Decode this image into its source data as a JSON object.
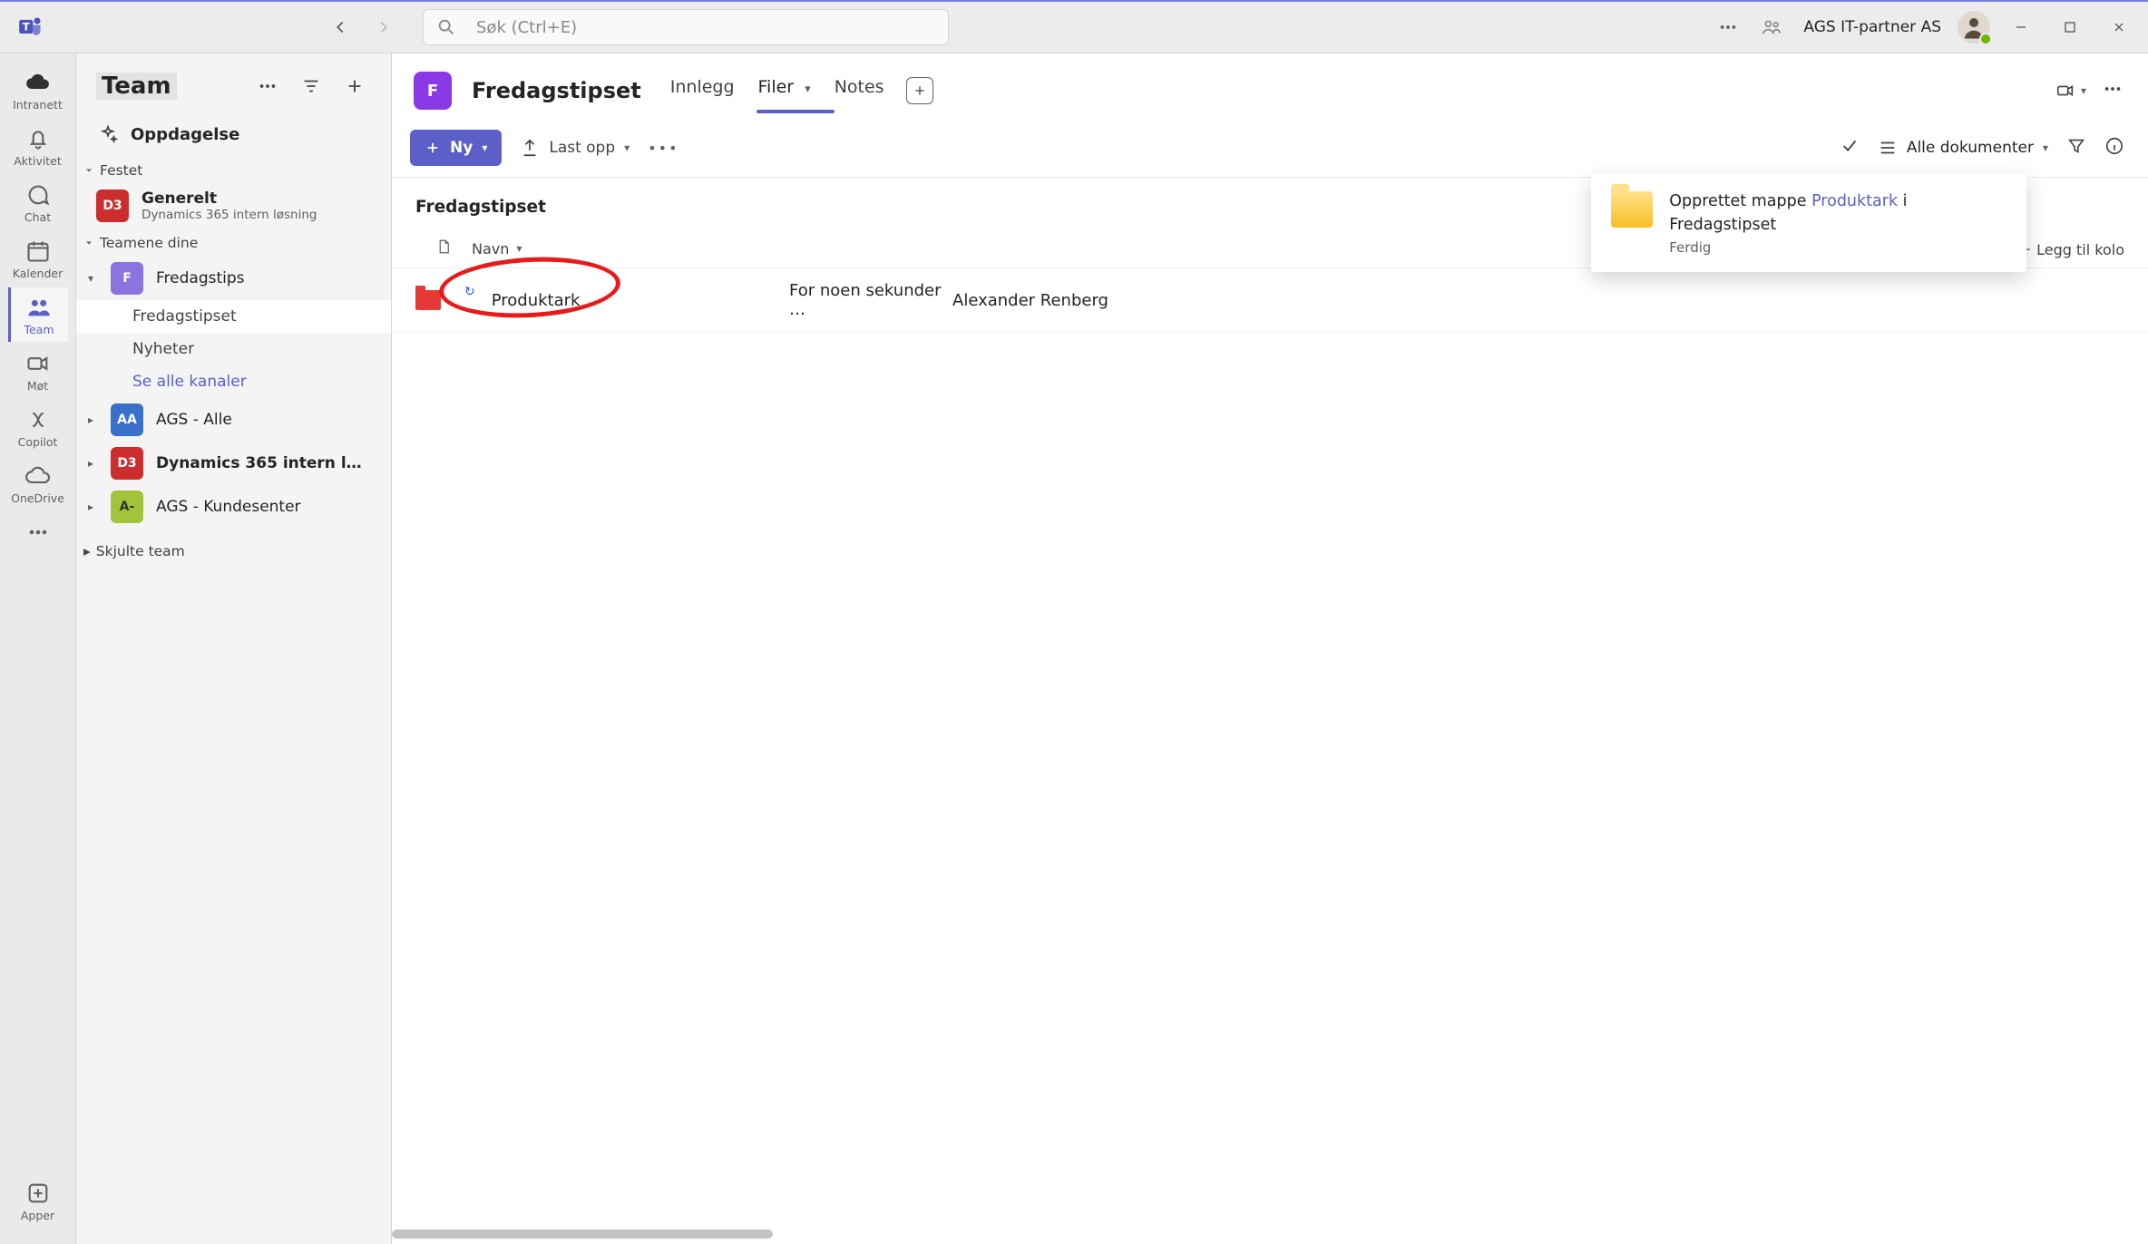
{
  "titlebar": {
    "search_placeholder": "Søk (Ctrl+E)",
    "tenant": "AGS IT-partner AS"
  },
  "rail": {
    "intranett": "Intranett",
    "aktivitet": "Aktivitet",
    "chat": "Chat",
    "kalender": "Kalender",
    "team": "Team",
    "mot": "Møt",
    "copilot": "Copilot",
    "onedrive": "OneDrive",
    "apper": "Apper"
  },
  "panel": {
    "title": "Team",
    "discover": "Oppdagelse",
    "pinned": "Festet",
    "yours": "Teamene dine",
    "hidden": "Skjulte team",
    "see_all": "Se alle kanaler",
    "generelt": {
      "name": "Generelt",
      "sub": "Dynamics 365 intern løsning",
      "badge": "D3"
    },
    "fredagstips": {
      "name": "Fredagstips",
      "badge": "F",
      "ch1": "Fredagstipset",
      "ch2": "Nyheter"
    },
    "ags_alle": {
      "name": "AGS - Alle",
      "badge": "AA"
    },
    "d365": {
      "name": "Dynamics 365 intern l…",
      "badge": "D3"
    },
    "kunde": {
      "name": "AGS - Kundesenter",
      "badge": "A-"
    }
  },
  "main": {
    "channel_title": "Fredagstipset",
    "tab_posts": "Innlegg",
    "tab_files": "Filer",
    "tab_notes": "Notes",
    "toolbar_new": "Ny",
    "toolbar_upload": "Last opp",
    "view_all": "Alle dokumenter",
    "breadcrumb": "Fredagstipset",
    "col_name": "Navn",
    "col_add": "Legg til kolo",
    "row": {
      "name": "Produktark",
      "modified": "For noen sekunder …",
      "by": "Alexander Renberg"
    }
  },
  "toast": {
    "prefix": "Opprettet mappe ",
    "link": "Produktark",
    "suffix": " i Fredagstipset",
    "status": "Ferdig"
  }
}
